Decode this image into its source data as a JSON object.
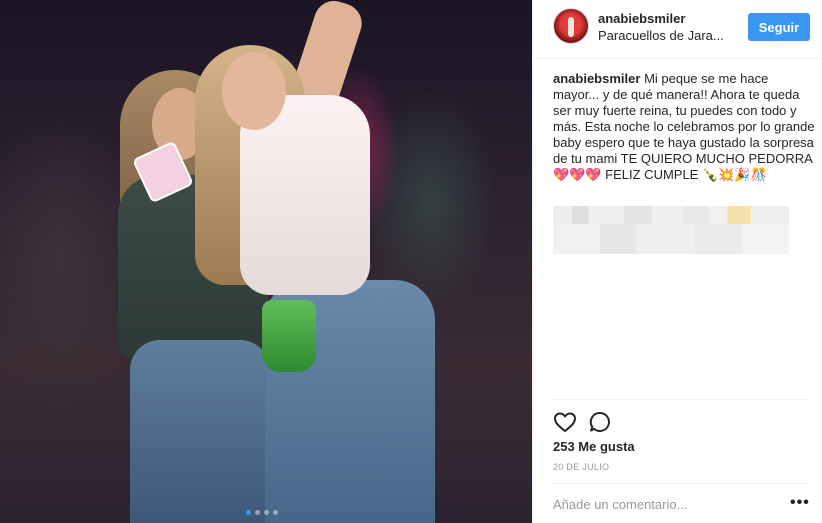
{
  "post": {
    "image_alt": "Two young women dancing at a night party",
    "carousel": {
      "count": 4,
      "active_index": 0
    }
  },
  "header": {
    "username": "anabiebsmiler",
    "location": "Paracuellos de Jara...",
    "follow_label": "Seguir"
  },
  "caption": {
    "username": "anabiebsmiler",
    "text": "Mi peque se me hace mayor... y de qué manera!! Ahora te queda ser muy fuerte reina, tu puedes con todo y más. Esta noche lo celebramos por lo grande baby espero que te haya gustado la sorpresa de tu mami TE QUIERO MUCHO PEDORRA 💖💖💖 FELIZ CUMPLE 🍾💥🎉🎊"
  },
  "actions": {
    "likes": "253 Me gusta",
    "date": "20 DE JULIO"
  },
  "comment_box": {
    "placeholder": "Añade un comentario...",
    "more_label": "•••"
  },
  "colors": {
    "accent": "#3897f0",
    "text": "#262626",
    "muted": "#999999",
    "border": "#efefef"
  },
  "icons": {
    "like": "heart-outline-icon",
    "comment": "speech-bubble-icon",
    "more": "ellipsis-icon"
  }
}
